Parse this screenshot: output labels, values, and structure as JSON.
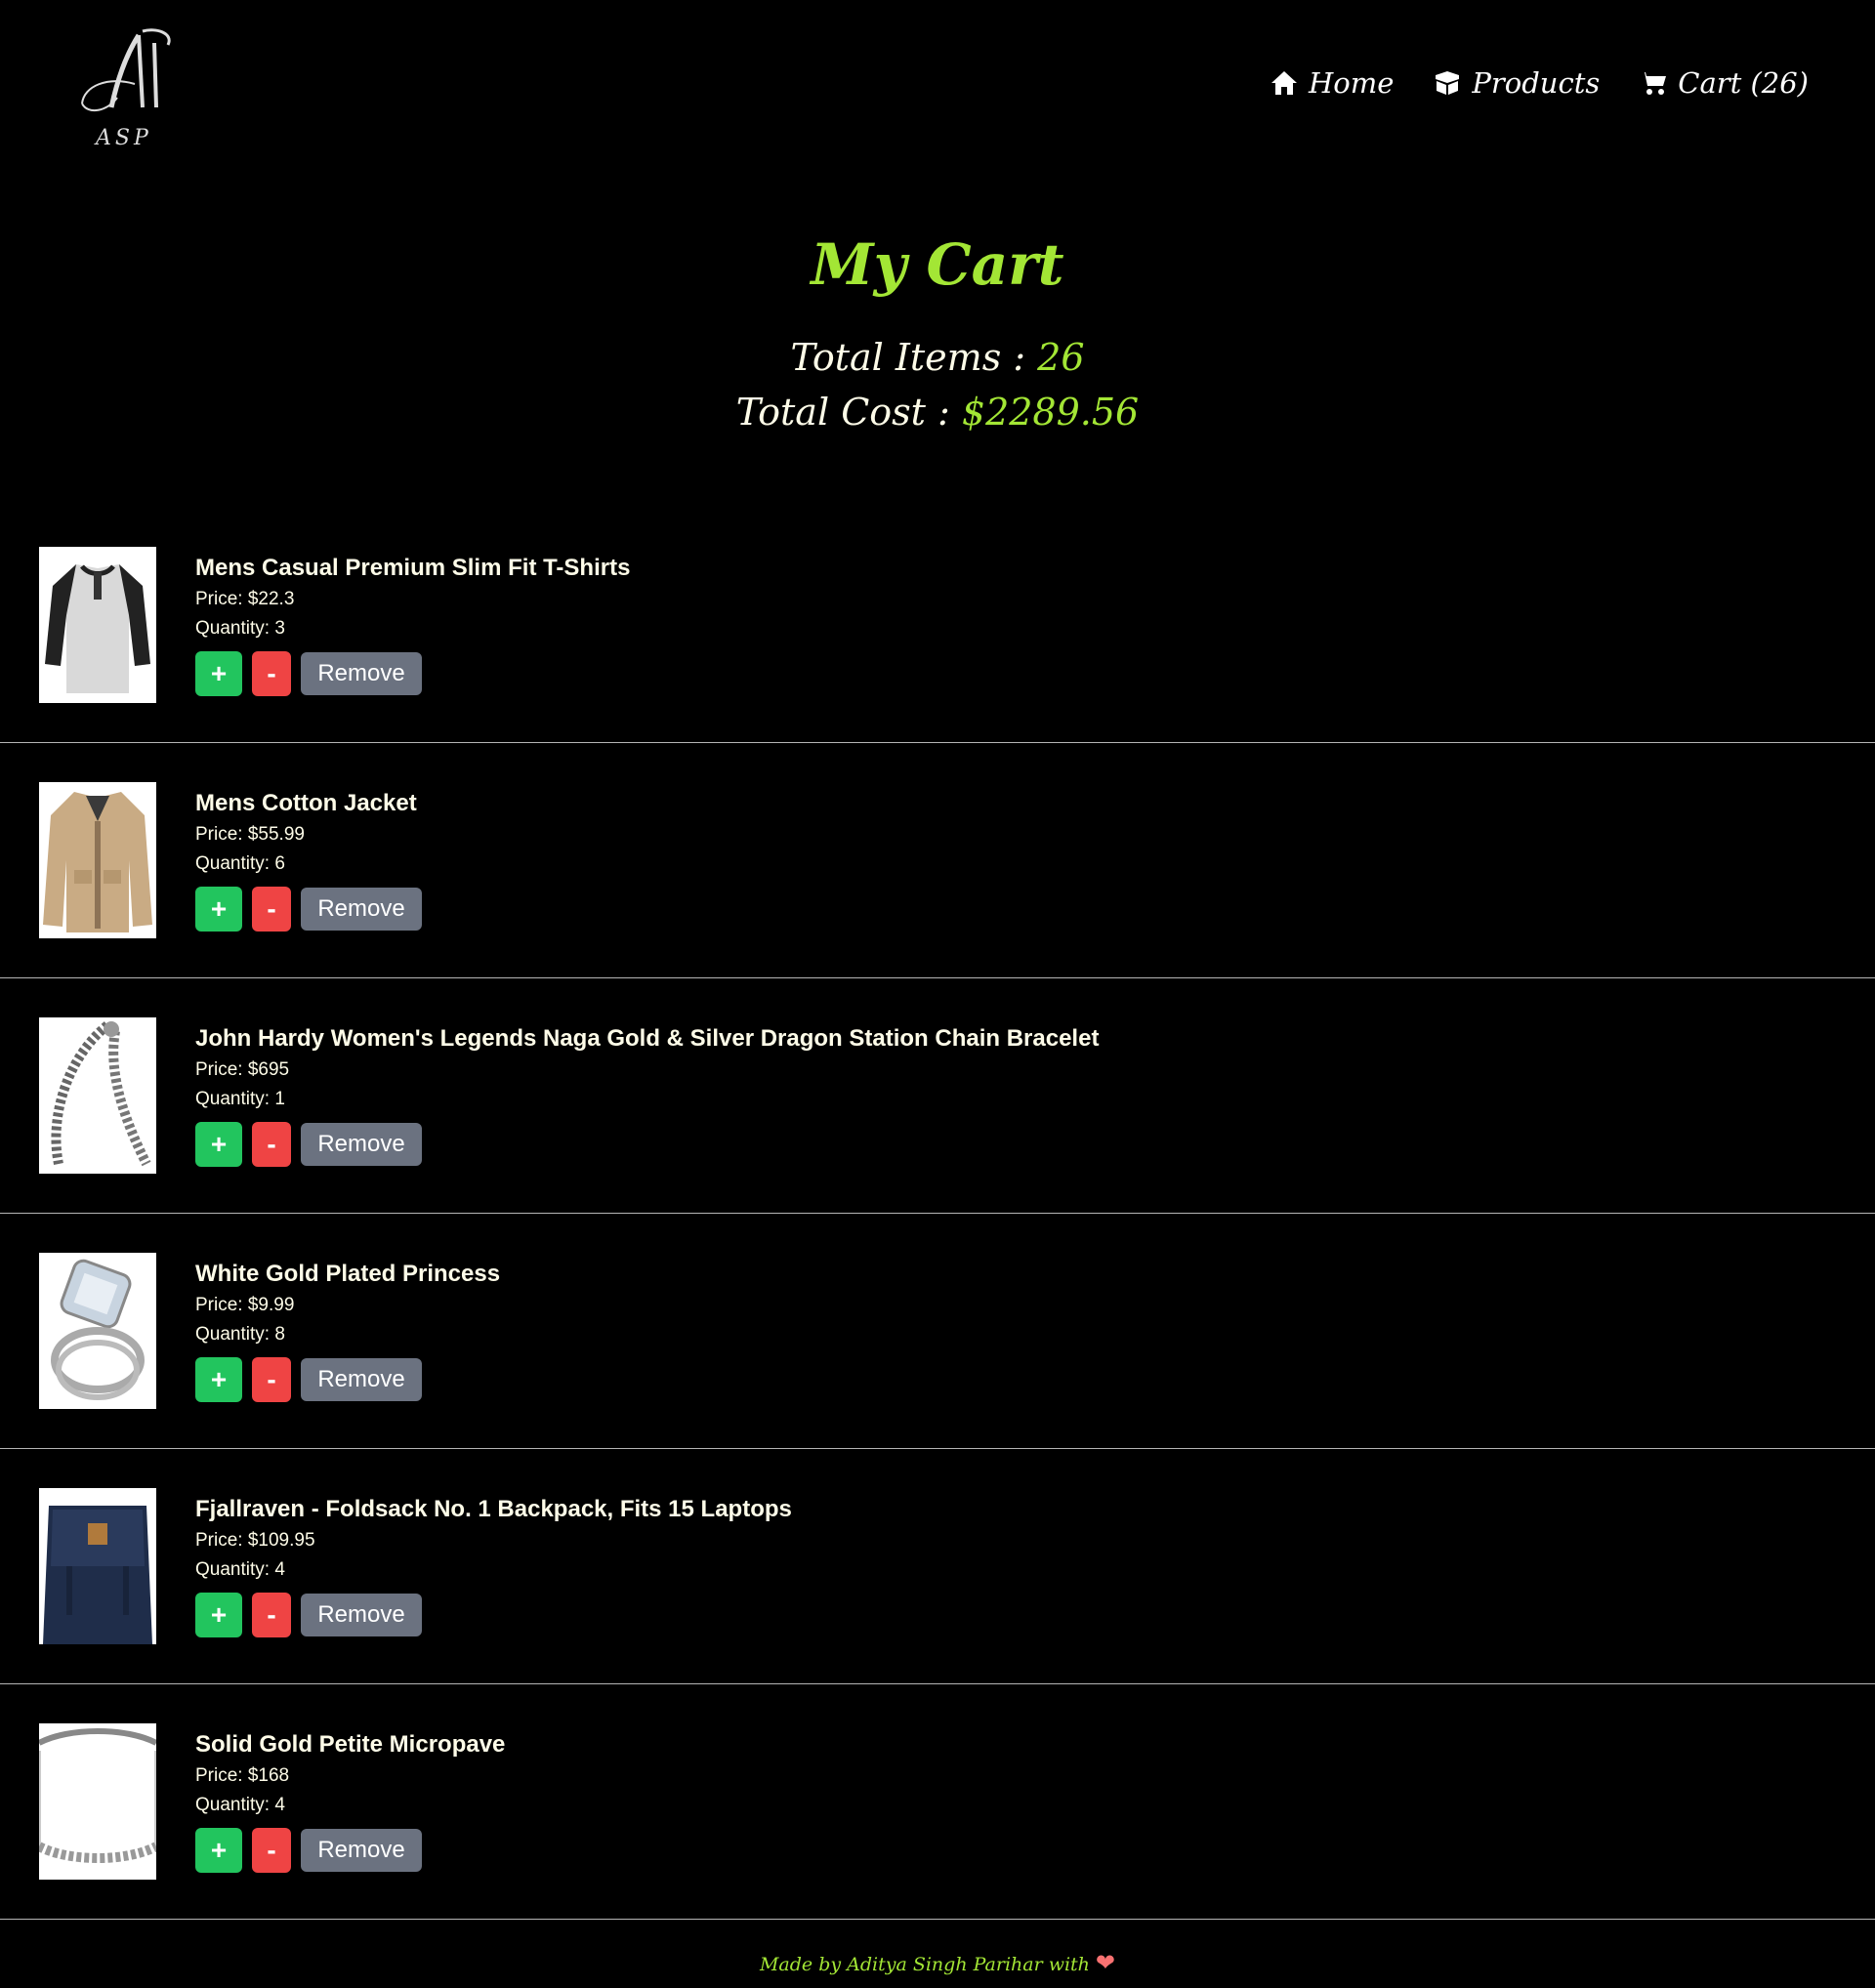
{
  "header": {
    "logo_text": "ASP",
    "nav": [
      {
        "label": "Home",
        "icon": "home-icon"
      },
      {
        "label": "Products",
        "icon": "box-icon"
      },
      {
        "label": "Cart (26)",
        "icon": "cart-icon"
      }
    ]
  },
  "summary": {
    "title": "My Cart",
    "total_items_label": "Total Items :",
    "total_items_value": "26",
    "total_cost_label": "Total Cost :",
    "total_cost_value": "$2289.56"
  },
  "items": [
    {
      "title": "Mens Casual Premium Slim Fit T-Shirts",
      "price": "Price: $22.3",
      "quantity": "Quantity: 3",
      "image": "tshirt-image"
    },
    {
      "title": "Mens Cotton Jacket",
      "price": "Price: $55.99",
      "quantity": "Quantity: 6",
      "image": "jacket-image"
    },
    {
      "title": "John Hardy Women's Legends Naga Gold & Silver Dragon Station Chain Bracelet",
      "price": "Price: $695",
      "quantity": "Quantity: 1",
      "image": "bracelet-image"
    },
    {
      "title": "White Gold Plated Princess",
      "price": "Price: $9.99",
      "quantity": "Quantity: 8",
      "image": "ring-image"
    },
    {
      "title": "Fjallraven - Foldsack No. 1 Backpack, Fits 15 Laptops",
      "price": "Price: $109.95",
      "quantity": "Quantity: 4",
      "image": "backpack-image"
    },
    {
      "title": "Solid Gold Petite Micropave",
      "price": "Price: $168",
      "quantity": "Quantity: 4",
      "image": "band-ring-image"
    }
  ],
  "buttons": {
    "plus": "+",
    "minus": "-",
    "remove": "Remove"
  },
  "footer": {
    "text": "Made by Aditya Singh Parihar with",
    "heart": "❤"
  },
  "colors": {
    "accent": "#a3e635",
    "plus": "#22c55e",
    "minus": "#ef4444",
    "remove": "#6b7280",
    "background": "#000000"
  }
}
